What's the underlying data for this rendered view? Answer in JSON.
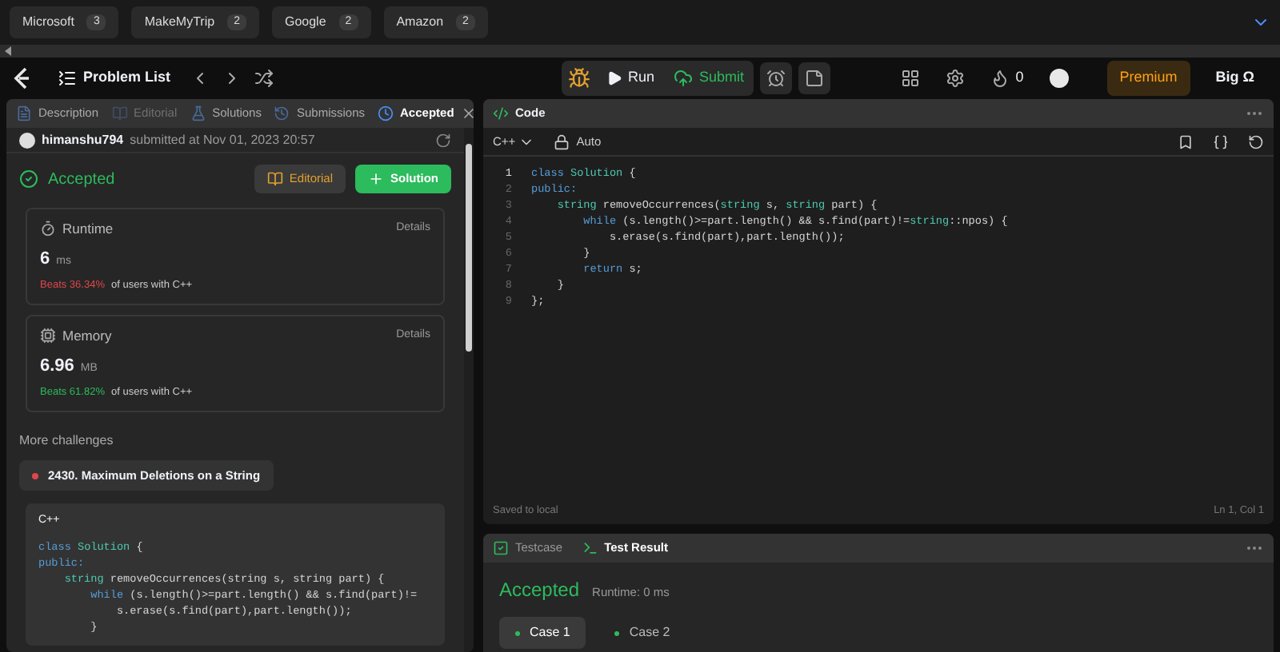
{
  "company_tags": [
    {
      "name": "Microsoft",
      "count": "3"
    },
    {
      "name": "MakeMyTrip",
      "count": "2"
    },
    {
      "name": "Google",
      "count": "2"
    },
    {
      "name": "Amazon",
      "count": "2"
    }
  ],
  "nav": {
    "problem_list": "Problem List",
    "run": "Run",
    "submit": "Submit",
    "streak": "0",
    "premium": "Premium",
    "brand": "Big Ω"
  },
  "left_panel": {
    "tabs": [
      {
        "label": "Description",
        "selected": false,
        "disabled": false
      },
      {
        "label": "Editorial",
        "selected": false,
        "disabled": true
      },
      {
        "label": "Solutions",
        "selected": false,
        "disabled": false
      },
      {
        "label": "Submissions",
        "selected": false,
        "disabled": false
      },
      {
        "label": "Accepted",
        "selected": true,
        "disabled": false
      }
    ],
    "user": "himanshu794",
    "submitted": "submitted at Nov 01, 2023 20:57",
    "status": "Accepted",
    "editorial_button": "Editorial",
    "solution_button": "Solution",
    "stats": [
      {
        "kind": "runtime",
        "title": "Runtime",
        "details": "Details",
        "value": "6",
        "unit": "ms",
        "beats": "Beats 36.34%",
        "color": "#e0464a",
        "suffix": "of users with C++"
      },
      {
        "kind": "memory",
        "title": "Memory",
        "details": "Details",
        "value": "6.96",
        "unit": "MB",
        "beats": "Beats 61.82%",
        "color": "#2cbb5d",
        "suffix": "of users with C++"
      }
    ],
    "more_challenges": "More challenges",
    "challenges": [
      {
        "title": "2430. Maximum Deletions on a String",
        "color": "#e0464a"
      }
    ],
    "snippet": {
      "language": "C++",
      "lines": [
        [
          {
            "text": "class ",
            "kind": "kw"
          },
          {
            "text": "Solution",
            "kind": "type"
          },
          {
            "text": " {",
            "kind": "plain"
          }
        ],
        [
          {
            "text": "public:",
            "kind": "kw"
          }
        ],
        [
          {
            "text": "    string ",
            "kind": "type"
          },
          {
            "text": "removeOccurrences(string s, string part) {",
            "kind": "plain"
          }
        ],
        [
          {
            "text": "        while",
            "kind": "kw"
          },
          {
            "text": " (s.length()>=part.length() && s.find(part)!=",
            "kind": "plain"
          }
        ],
        [
          {
            "text": "            s.erase(s.find(part),part.length());",
            "kind": "plain"
          }
        ],
        [
          {
            "text": "        }",
            "kind": "plain"
          }
        ]
      ]
    }
  },
  "code_panel": {
    "title": "Code",
    "language": "C++",
    "mode": "Auto",
    "lines": [
      {
        "number": "1",
        "tokens": [
          {
            "text": "class ",
            "kind": "kw"
          },
          {
            "text": "Solution",
            "kind": "type"
          },
          {
            "text": " {",
            "kind": "plain"
          }
        ]
      },
      {
        "number": "2",
        "tokens": [
          {
            "text": "public:",
            "kind": "kw"
          }
        ]
      },
      {
        "number": "3",
        "tokens": [
          {
            "text": "    string ",
            "kind": "type"
          },
          {
            "text": "removeOccurrences(",
            "kind": "plain"
          },
          {
            "text": "string",
            "kind": "type"
          },
          {
            "text": " s, ",
            "kind": "plain"
          },
          {
            "text": "string",
            "kind": "type"
          },
          {
            "text": " part) {",
            "kind": "plain"
          }
        ]
      },
      {
        "number": "4",
        "tokens": [
          {
            "text": "        while",
            "kind": "kw"
          },
          {
            "text": " (s.length()>=part.length() && s.find(part)!=",
            "kind": "plain"
          },
          {
            "text": "string",
            "kind": "type"
          },
          {
            "text": "::npos) {",
            "kind": "plain"
          }
        ]
      },
      {
        "number": "5",
        "tokens": [
          {
            "text": "            s.erase(s.find(part),part.length());",
            "kind": "plain"
          }
        ]
      },
      {
        "number": "6",
        "tokens": [
          {
            "text": "        }",
            "kind": "plain"
          }
        ]
      },
      {
        "number": "7",
        "tokens": [
          {
            "text": "        return",
            "kind": "kw"
          },
          {
            "text": " s;",
            "kind": "plain"
          }
        ]
      },
      {
        "number": "8",
        "tokens": [
          {
            "text": "    }",
            "kind": "plain"
          }
        ]
      },
      {
        "number": "9",
        "tokens": [
          {
            "text": "};",
            "kind": "plain"
          }
        ]
      }
    ],
    "saved": "Saved to local",
    "cursor": "Ln 1, Col 1"
  },
  "result_panel": {
    "tabs": [
      {
        "label": "Testcase",
        "selected": false
      },
      {
        "label": "Test Result",
        "selected": true
      }
    ],
    "status": "Accepted",
    "runtime": "Runtime: 0 ms",
    "cases": [
      {
        "label": "Case 1",
        "selected": true
      },
      {
        "label": "Case 2",
        "selected": false
      }
    ]
  }
}
